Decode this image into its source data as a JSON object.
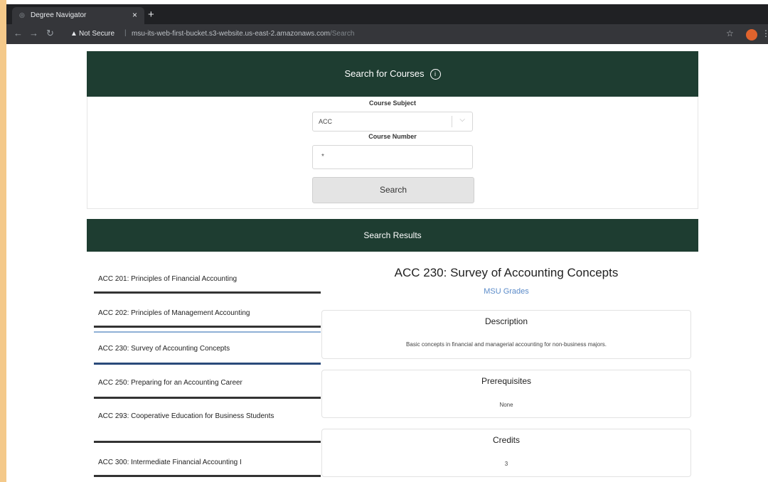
{
  "browser": {
    "tab_title": "Degree Navigator",
    "tab_close": "×",
    "new_tab": "+",
    "security_label": "Not Secure",
    "url_host": "msu-its-web-first-bucket.s3-website.us-east-2.amazonaws.com",
    "url_path": "/Search"
  },
  "search": {
    "header": "Search for Courses",
    "info_glyph": "i",
    "subject_label": "Course Subject",
    "subject_value": "ACC",
    "number_label": "Course Number",
    "number_value": "*",
    "button_label": "Search"
  },
  "results": {
    "header": "Search Results",
    "items": [
      {
        "label": "ACC 201: Principles of Financial Accounting"
      },
      {
        "label": "ACC 202: Principles of Management Accounting"
      },
      {
        "label": "ACC 230: Survey of Accounting Concepts"
      },
      {
        "label": "ACC 250: Preparing for an Accounting Career"
      },
      {
        "label": "ACC 293: Cooperative Education for Business Students"
      },
      {
        "label": "ACC 300: Intermediate Financial Accounting I"
      }
    ],
    "selected_index": 2
  },
  "detail": {
    "title": "ACC 230: Survey of Accounting Concepts",
    "grades_link": "MSU Grades",
    "description_heading": "Description",
    "description": "Basic concepts in financial and managerial accounting for non-business majors.",
    "prereq_heading": "Prerequisites",
    "prereq_value": "None",
    "credits_heading": "Credits",
    "credits_value": "3"
  },
  "colors": {
    "header_bg": "#1e3d31",
    "link": "#5b8bc9"
  }
}
